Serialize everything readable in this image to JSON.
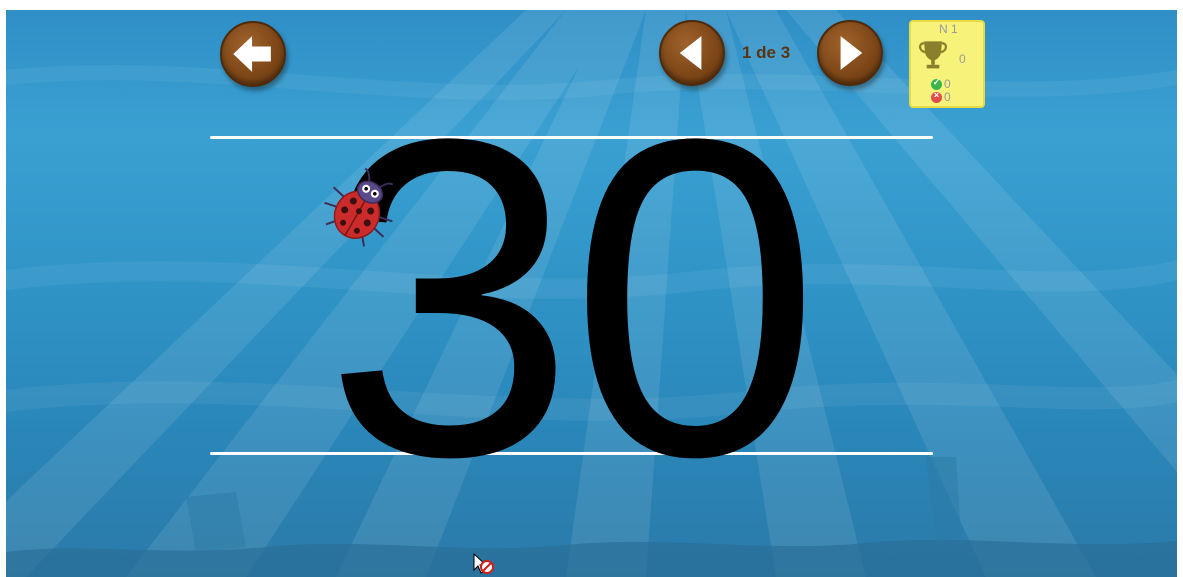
{
  "header": {
    "back_icon": "arrow-left-icon",
    "prev_icon": "triangle-left-icon",
    "next_icon": "triangle-right-icon",
    "page_indicator": "1 de 3"
  },
  "score": {
    "level": "N 1",
    "trophy_icon": "trophy-icon",
    "points": "0",
    "correct": "0",
    "errors": "0"
  },
  "exercise": {
    "number": "30",
    "guide_character": "ladybug"
  },
  "colors": {
    "water": "#2f93c6",
    "button": "#7b4516",
    "score_panel": "#f7f27a",
    "digit": "#000000",
    "guide_line": "#ffffff"
  }
}
